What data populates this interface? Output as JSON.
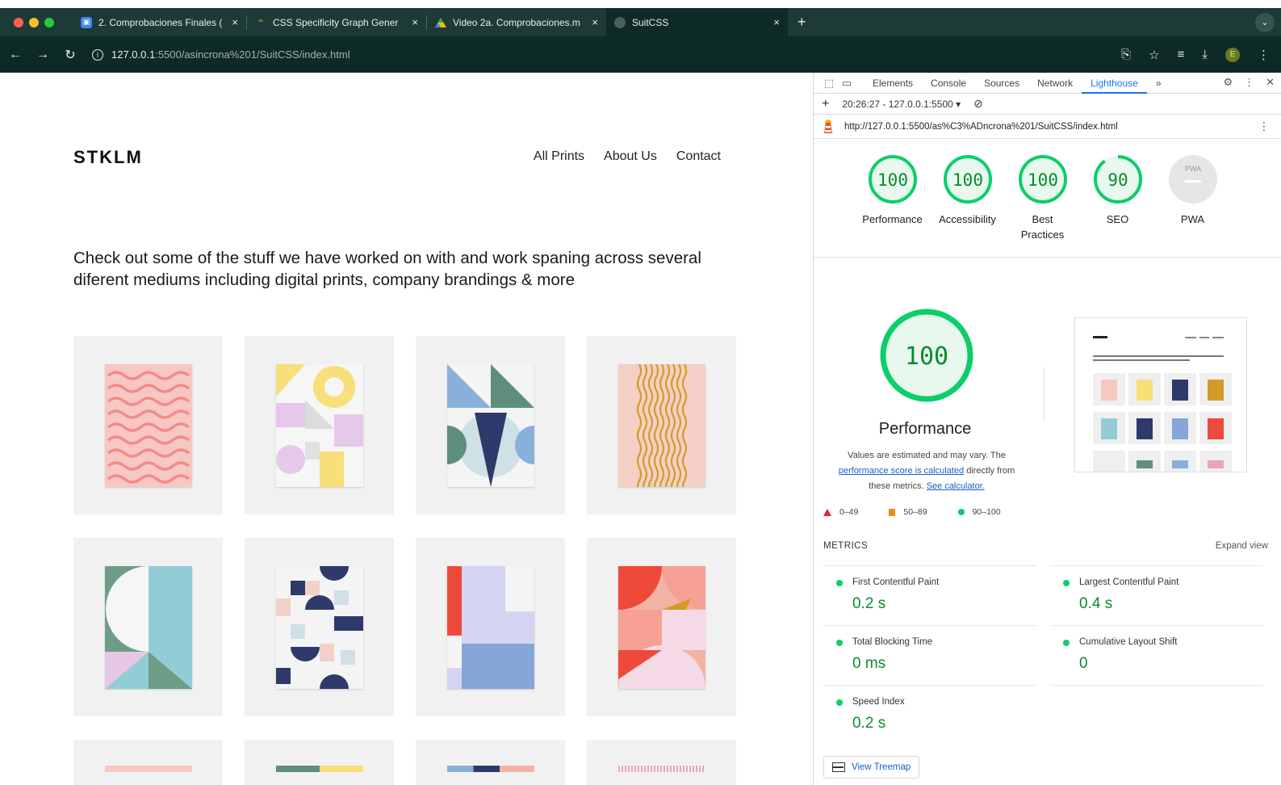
{
  "browser": {
    "tabs": [
      {
        "title": "2. Comprobaciones Finales (",
        "icon": "classroom-icon",
        "active": false
      },
      {
        "title": "CSS Specificity Graph Gener",
        "icon": "specificity-icon",
        "active": false
      },
      {
        "title": "Video 2a. Comprobaciones.m",
        "icon": "drive-icon",
        "active": false
      },
      {
        "title": "SuitCSS",
        "icon": "globe-icon",
        "active": true
      }
    ],
    "new_tab": "+",
    "close": "×",
    "url_host": "127.0.0.1",
    "url_rest": ":5500/asincrona%201/SuitCSS/index.html",
    "profile_initial": "E"
  },
  "site": {
    "brand": "STKLM",
    "nav": [
      "All Prints",
      "About Us",
      "Contact"
    ],
    "intro": "Check out some of the stuff we have worked on with and work spaning across several diferent mediums including digital prints, company brandings & more"
  },
  "devtools": {
    "tabs": [
      "Elements",
      "Console",
      "Sources",
      "Network",
      "Lighthouse"
    ],
    "more": "»",
    "report_time": "20:26:27 - 127.0.0.1:5500 ▾",
    "report_url": "http://127.0.0.1:5500/as%C3%ADncrona%201/SuitCSS/index.html",
    "scores": [
      {
        "value": "100",
        "label": "Performance",
        "score": 1.0
      },
      {
        "value": "100",
        "label": "Accessibility",
        "score": 1.0
      },
      {
        "value": "100",
        "label": "Best Practices",
        "score": 1.0
      },
      {
        "value": "90",
        "label": "SEO",
        "score": 0.9
      },
      {
        "value": "PWA",
        "label": "PWA",
        "score": null
      }
    ],
    "perf": {
      "score": "100",
      "title": "Performance",
      "desc_1": "Values are estimated and may vary. The",
      "desc_link": "performance score is calculated",
      "desc_2": " directly from",
      "desc_3": "these metrics. ",
      "desc_link2": "See calculator."
    },
    "legend": [
      "0–49",
      "50–89",
      "90–100"
    ],
    "metrics_heading": "METRICS",
    "expand_view": "Expand view",
    "metrics": [
      {
        "name": "First Contentful Paint",
        "value": "0.2 s"
      },
      {
        "name": "Largest Contentful Paint",
        "value": "0.4 s"
      },
      {
        "name": "Total Blocking Time",
        "value": "0 ms"
      },
      {
        "name": "Cumulative Layout Shift",
        "value": "0"
      },
      {
        "name": "Speed Index",
        "value": "0.2 s"
      }
    ],
    "treemap": "View Treemap"
  },
  "colors": {
    "pass": "#0cce6b",
    "pass_text": "#0b8a2e",
    "average": "#f28a18",
    "fail": "#e3242b",
    "chrome_frame": "#0d2a27"
  }
}
